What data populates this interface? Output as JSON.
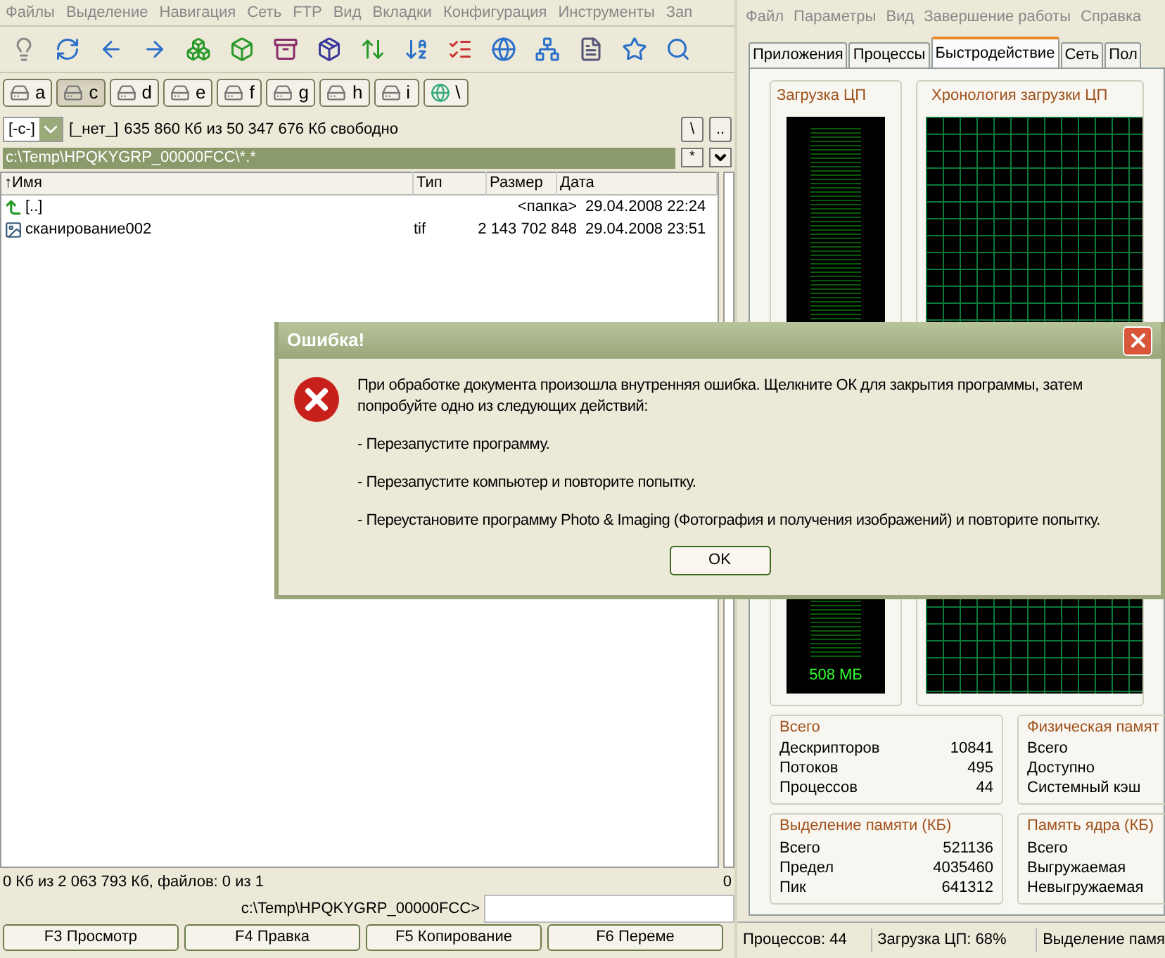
{
  "commander": {
    "menu": [
      "Файлы",
      "Выделение",
      "Навигация",
      "Сеть",
      "FTP",
      "Вид",
      "Вкладки",
      "Конфигурация",
      "Инструменты",
      "Зап"
    ],
    "drives": [
      {
        "label": "a",
        "selected": false
      },
      {
        "label": "c",
        "selected": true
      },
      {
        "label": "d",
        "selected": false
      },
      {
        "label": "e",
        "selected": false
      },
      {
        "label": "f",
        "selected": false
      },
      {
        "label": "g",
        "selected": false
      },
      {
        "label": "h",
        "selected": false
      },
      {
        "label": "i",
        "selected": false
      },
      {
        "label": "\\",
        "selected": false
      }
    ],
    "drive_box": "[-c-]",
    "volume": "[_нет_]",
    "free_space": "635 860 Кб из 50 347 676 Кб свободно",
    "nav_buttons": [
      "\\",
      ".."
    ],
    "path": "c:\\Temp\\HPQKYGRP_00000FCC\\*.*",
    "filter_button": "*",
    "columns": [
      "↑Имя",
      "Тип",
      "Размер",
      "Дата"
    ],
    "rows": [
      {
        "kind": "up",
        "name": "[..]",
        "size": "<папка>",
        "date": "29.04.2008 22:24"
      },
      {
        "kind": "file",
        "name": "сканирование002",
        "type": "tif",
        "size": "2 143 702 848",
        "date": "29.04.2008 23:51"
      }
    ],
    "status": "0 Кб из 2 063 793 Кб, файлов: 0 из 1",
    "right_status": "0",
    "prompt": "c:\\Temp\\HPQKYGRP_00000FCC>",
    "fkeys": [
      "F3 Просмотр",
      "F4 Правка",
      "F5 Копирование",
      "F6 Переме"
    ]
  },
  "task_manager": {
    "menu": [
      "Файл",
      "Параметры",
      "Вид",
      "Завершение работы",
      "Справка"
    ],
    "tabs": [
      {
        "label": "Приложения",
        "selected": false
      },
      {
        "label": "Процессы",
        "selected": false
      },
      {
        "label": "Быстродействие",
        "selected": true
      },
      {
        "label": "Сеть",
        "selected": false
      },
      {
        "label": "Пол",
        "selected": false
      }
    ],
    "cpu_title": "Загрузка ЦП",
    "history_title": "Хронология загрузки ЦП",
    "memory_reading": "508 МБ",
    "groups": [
      {
        "title": "Всего",
        "rows": [
          {
            "label": "Дескрипторов",
            "value": "10841"
          },
          {
            "label": "Потоков",
            "value": "495"
          },
          {
            "label": "Процессов",
            "value": "44"
          }
        ]
      },
      {
        "title": "Физическая памят",
        "rows": [
          {
            "label": "Всего"
          },
          {
            "label": "Доступно"
          },
          {
            "label": "Системный кэш"
          }
        ]
      },
      {
        "title": "Выделение памяти (КБ)",
        "rows": [
          {
            "label": "Всего",
            "value": "521136"
          },
          {
            "label": "Предел",
            "value": "4035460"
          },
          {
            "label": "Пик",
            "value": "641312"
          }
        ]
      },
      {
        "title": "Память ядра (КБ)",
        "rows": [
          {
            "label": "Всего"
          },
          {
            "label": "Выгружаемая"
          },
          {
            "label": "Невыгружаемая"
          }
        ]
      }
    ],
    "status": [
      "Процессов: 44",
      "Загрузка ЦП: 68%",
      "Выделение памя"
    ]
  },
  "dialog": {
    "title": "Ошибка!",
    "paragraphs": [
      "При обработке документа произошла внутренняя ошибка. Щелкните ОК для закрытия программы, затем попробуйте одно из следующих действий:",
      "- Перезапустите программу.",
      "- Перезапустите компьютер и повторите попытку.",
      "- Переустановите программу Photo & Imaging (Фотография и получения изображений) и повторите попытку."
    ],
    "button": "OK"
  }
}
